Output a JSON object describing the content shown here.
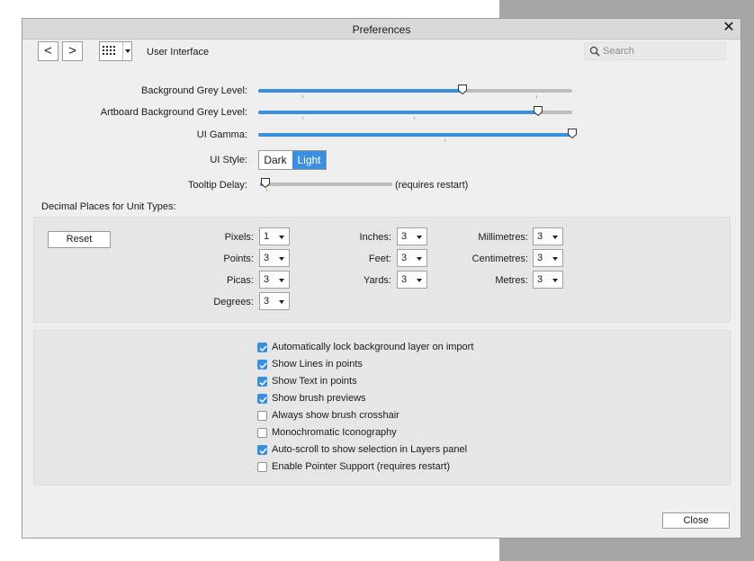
{
  "window": {
    "title": "Preferences"
  },
  "toolbar": {
    "back_label": "<",
    "forward_label": ">",
    "section_label": "User Interface",
    "search_placeholder": "Search",
    "search_value": ""
  },
  "sliders": {
    "background_grey_level": {
      "label": "Background Grey Level:",
      "value": 0.65
    },
    "artboard_grey_level": {
      "label": "Artboard Background Grey Level:",
      "value": 0.89
    },
    "ui_gamma": {
      "label": "UI Gamma:",
      "value": 1.0
    },
    "tooltip_delay": {
      "label": "Tooltip Delay:",
      "value": 0.04,
      "note": "(requires restart)"
    }
  },
  "ui_style": {
    "label": "UI Style:",
    "options": [
      "Dark",
      "Light"
    ],
    "selected": "Light"
  },
  "decimal_places": {
    "title": "Decimal Places for Unit Types:",
    "reset_label": "Reset",
    "units": [
      {
        "label": "Pixels:",
        "value": "1"
      },
      {
        "label": "Points:",
        "value": "3"
      },
      {
        "label": "Picas:",
        "value": "3"
      },
      {
        "label": "Degrees:",
        "value": "3"
      },
      {
        "label": "Inches:",
        "value": "3"
      },
      {
        "label": "Feet:",
        "value": "3"
      },
      {
        "label": "Yards:",
        "value": "3"
      },
      {
        "label": "Millimetres:",
        "value": "3"
      },
      {
        "label": "Centimetres:",
        "value": "3"
      },
      {
        "label": "Metres:",
        "value": "3"
      }
    ]
  },
  "options": [
    {
      "label": "Automatically lock background layer on import",
      "checked": true
    },
    {
      "label": "Show Lines in points",
      "checked": true
    },
    {
      "label": "Show Text in points",
      "checked": true
    },
    {
      "label": "Show brush previews",
      "checked": true
    },
    {
      "label": "Always show brush crosshair",
      "checked": false
    },
    {
      "label": "Monochromatic Iconography",
      "checked": false
    },
    {
      "label": "Auto-scroll to show selection in Layers panel",
      "checked": true
    },
    {
      "label": "Enable Pointer Support (requires restart)",
      "checked": false
    }
  ],
  "footer": {
    "close_label": "Close"
  },
  "colors": {
    "accent": "#3c8fdf",
    "dialog_bg": "#efefef",
    "panel_bg": "#e6e6e6",
    "titlebar_bg": "#d9d9d9"
  }
}
